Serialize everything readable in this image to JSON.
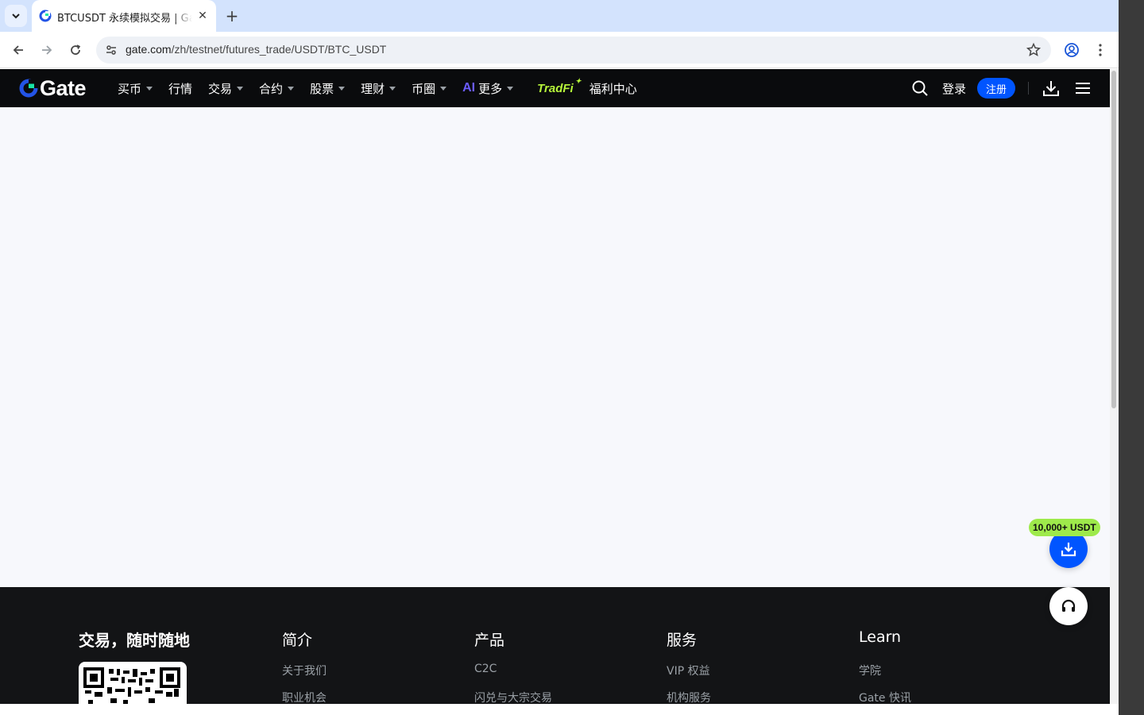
{
  "browser": {
    "tab_title": "BTCUSDT 永续模拟交易 | Gate",
    "url_host": "gate.com",
    "url_path": "/zh/testnet/futures_trade/USDT/BTC_USDT",
    "new_tab_label": "+",
    "close_label": "✕"
  },
  "header": {
    "logo_text": "Gate",
    "nav": [
      {
        "label": "买币",
        "has_caret": true
      },
      {
        "label": "行情",
        "has_caret": false
      },
      {
        "label": "交易",
        "has_caret": true
      },
      {
        "label": "合约",
        "has_caret": true
      },
      {
        "label": "股票",
        "has_caret": true
      },
      {
        "label": "理财",
        "has_caret": true
      },
      {
        "label": "币圈",
        "has_caret": true
      },
      {
        "label": "更多",
        "has_caret": true,
        "prefix": "AI"
      }
    ],
    "tradfi_label": "TradFi",
    "welfare_label": "福利中心",
    "login_label": "登录",
    "register_label": "注册"
  },
  "floating": {
    "badge_text": "10,000+ USDT"
  },
  "footer": {
    "slogan": "交易，随时随地",
    "columns": [
      {
        "title": "简介",
        "links": [
          "关于我们",
          "职业机会"
        ]
      },
      {
        "title": "产品",
        "links": [
          "C2C",
          "闪兑与大宗交易"
        ]
      },
      {
        "title": "服务",
        "links": [
          "VIP 权益",
          "机构服务"
        ]
      },
      {
        "title": "Learn",
        "links": [
          "学院",
          "Gate 快讯"
        ]
      }
    ]
  },
  "colors": {
    "brand_blue": "#0055ff",
    "header_bg": "#0a0b0d",
    "badge_green": "#9eea4b",
    "tradfi_green": "#b7f53a"
  }
}
